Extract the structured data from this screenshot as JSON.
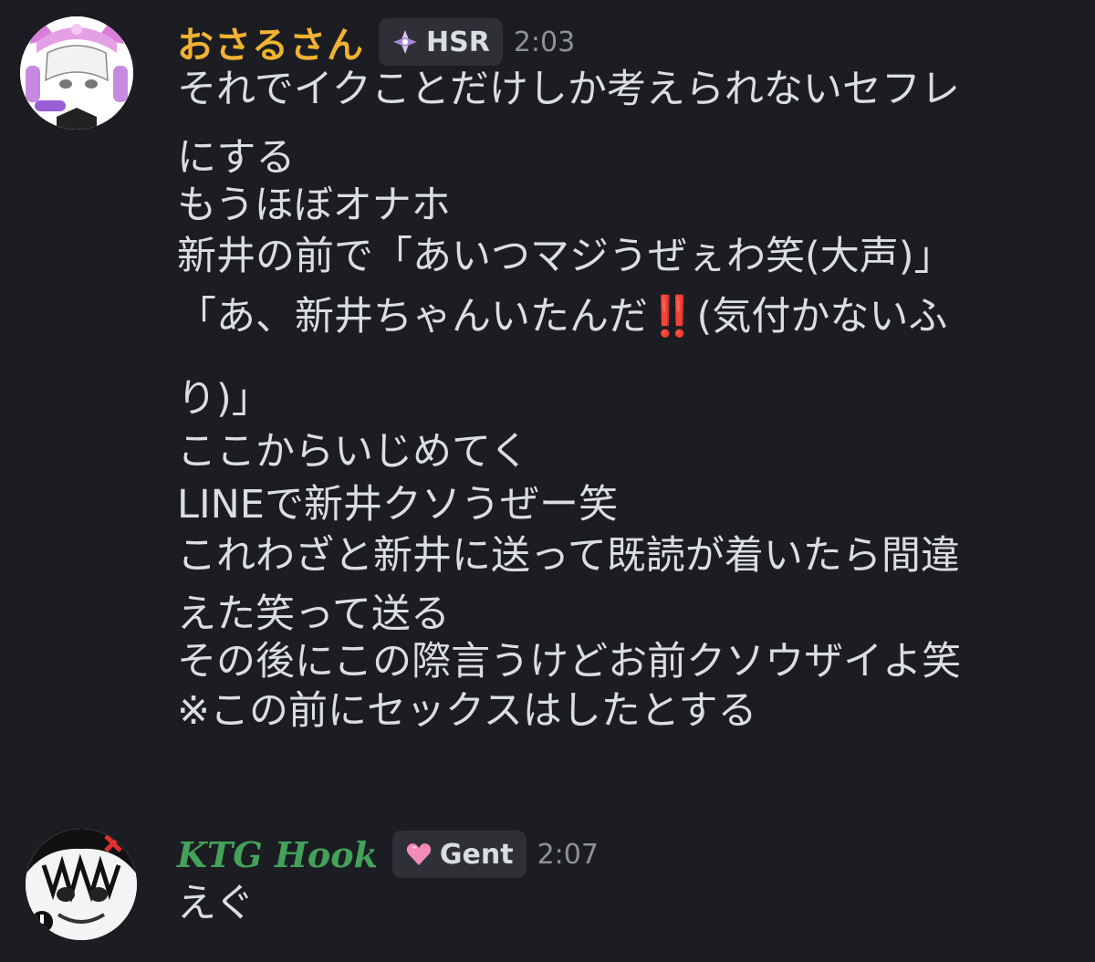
{
  "messages": [
    {
      "username": "おさるさん",
      "tag": "HSR",
      "tag_icon": "sparkle-diamond-icon",
      "time": "2:03",
      "username_color": "#f0b232",
      "lines": [
        "それでイクことだけしか考えられないセフレ",
        "にする",
        "もうほぼオナホ",
        "新井の前で「あいつマジうぜぇわ笑(大声)」",
        "「あ、新井ちゃんいたんだ‼️(気付かないふ",
        "り)」",
        "ここからいじめてく",
        "LINEで新井クソうぜー笑",
        "これわざと新井に送って既読が着いたら間違",
        "えた笑って送る",
        "その後にこの際言うけどお前クソウザイよ笑",
        "※この前にセックスはしたとする"
      ]
    },
    {
      "username": "KTG Hook",
      "tag": "Gent",
      "tag_icon": "pink-heart-icon",
      "time": "2:07",
      "username_color": "#43a25a",
      "lines": [
        "えぐ"
      ]
    }
  ]
}
